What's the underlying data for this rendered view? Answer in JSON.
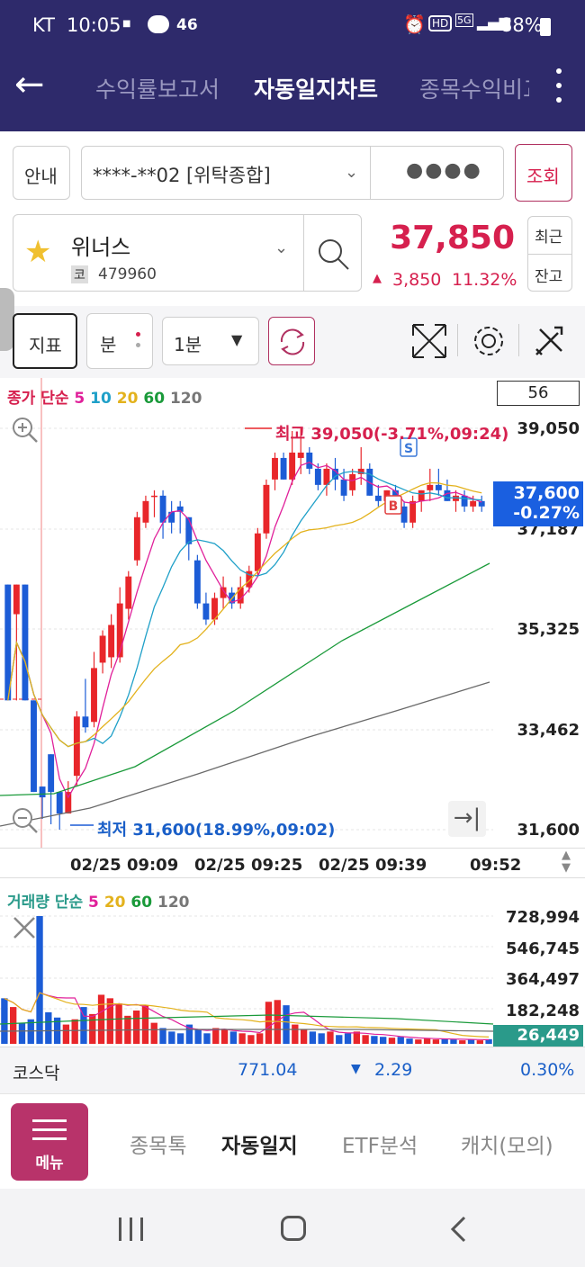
{
  "status": {
    "carrier": "KT",
    "time": "10:05",
    "net": "46",
    "battery": "88%",
    "hd": "HD",
    "g5": "5G"
  },
  "header": {
    "tabs": [
      "수익률보고서",
      "자동일지차트",
      "종목수익비교"
    ],
    "active_tab": 1
  },
  "account": {
    "guide_label": "안내",
    "account_number": "****-**02 [위탁종합]",
    "password_mask": "●●●●",
    "query_label": "조회"
  },
  "stock": {
    "name": "위너스",
    "market_badge": "코",
    "code": "479960",
    "price": "37,850",
    "change": "3,850",
    "change_pct": "11.32%",
    "recent_label": "최근",
    "balance_label": "잔고"
  },
  "toolbar": {
    "indicator_label": "지표",
    "unit_label": "분",
    "interval": "1분"
  },
  "price_chart": {
    "legend": {
      "prefix": "종가 단순",
      "ma": [
        "5",
        "10",
        "20",
        "60",
        "120"
      ]
    },
    "count": "56",
    "high_label": "최고 39,050(-3.71%,09:24)",
    "low_label": "최저 31,600(18.99%,09:02)",
    "y_ticks": [
      "39,050",
      "37,187",
      "35,325",
      "33,462",
      "31,600"
    ],
    "current_price": "37,600",
    "current_pct": "-0.27%",
    "sell_marker": "S",
    "buy_marker": "B"
  },
  "time_axis": [
    "02/25 09:09",
    "02/25 09:25",
    "02/25 09:39",
    "09:52"
  ],
  "volume_chart": {
    "legend": {
      "prefix": "거래량 단순",
      "ma": [
        "5",
        "20",
        "60",
        "120"
      ]
    },
    "y_ticks": [
      "728,994",
      "546,745",
      "364,497",
      "182,248"
    ],
    "current": "26,449"
  },
  "index_bar": {
    "name": "코스닥",
    "value": "771.04",
    "change": "2.29",
    "pct": "0.30%"
  },
  "bottom_nav": {
    "menu_label": "메뉴",
    "items": [
      "종목톡",
      "자동일지",
      "ETF분석",
      "캐치(모의)"
    ],
    "active": 1
  },
  "colors": {
    "header": "#2e2a6b",
    "up": "#e8262a",
    "down": "#1c5cd6",
    "accent": "#d6204e",
    "ma5": "#e0209a",
    "ma10": "#1fa0c8",
    "ma20": "#e3b21d",
    "ma60": "#1a9a3a",
    "ma120": "#6a6a6a"
  }
}
